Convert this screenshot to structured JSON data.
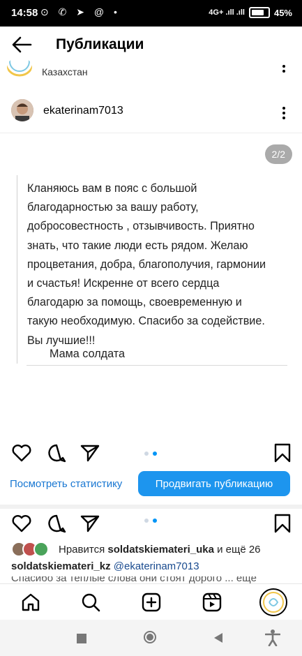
{
  "status": {
    "time": "14:58",
    "left_icons": "⊙ ✆ ➤ @ •",
    "network": "4G+ .ıll .ıll",
    "battery": "45%"
  },
  "header": {
    "title": "Публикации",
    "back_icon": "arrow-left-icon"
  },
  "previous_post": {
    "location": "Казахстан"
  },
  "post": {
    "username": "ekaterinam7013",
    "counter": "2/2",
    "text": "Кланяюсь вам в пояс с большой\nблагодарностью за вашу работу,\nдобросовестность , отзывчивость. Приятно\nзнать, что такие люди есть рядом. Желаю\nпроцветания, добра, благополучия, гармонии\nи счастья! Искренне от всего сердца\nблагодарю за помощь, своевременную и\nтакую необходимую. Спасибо за содействие.\nВы лучшие!!!",
    "signature": "Мама солдата"
  },
  "actions": {
    "stats_link": "Посмотреть статистику",
    "promote_button": "Продвигать публикацию"
  },
  "next_post": {
    "likes_prefix": "Нравится ",
    "likes_user": "soldatskiematerі_uka",
    "likes_suffix": " и ещё 26",
    "caption_user": "soldatskiemateri_kz",
    "caption_mention": "@ekaterinam7013",
    "caption_preview": "Спасибо за теплые слова они стоят дорого ... ещё"
  },
  "colors": {
    "accent": "#1d95ee",
    "link": "#1877d2"
  }
}
